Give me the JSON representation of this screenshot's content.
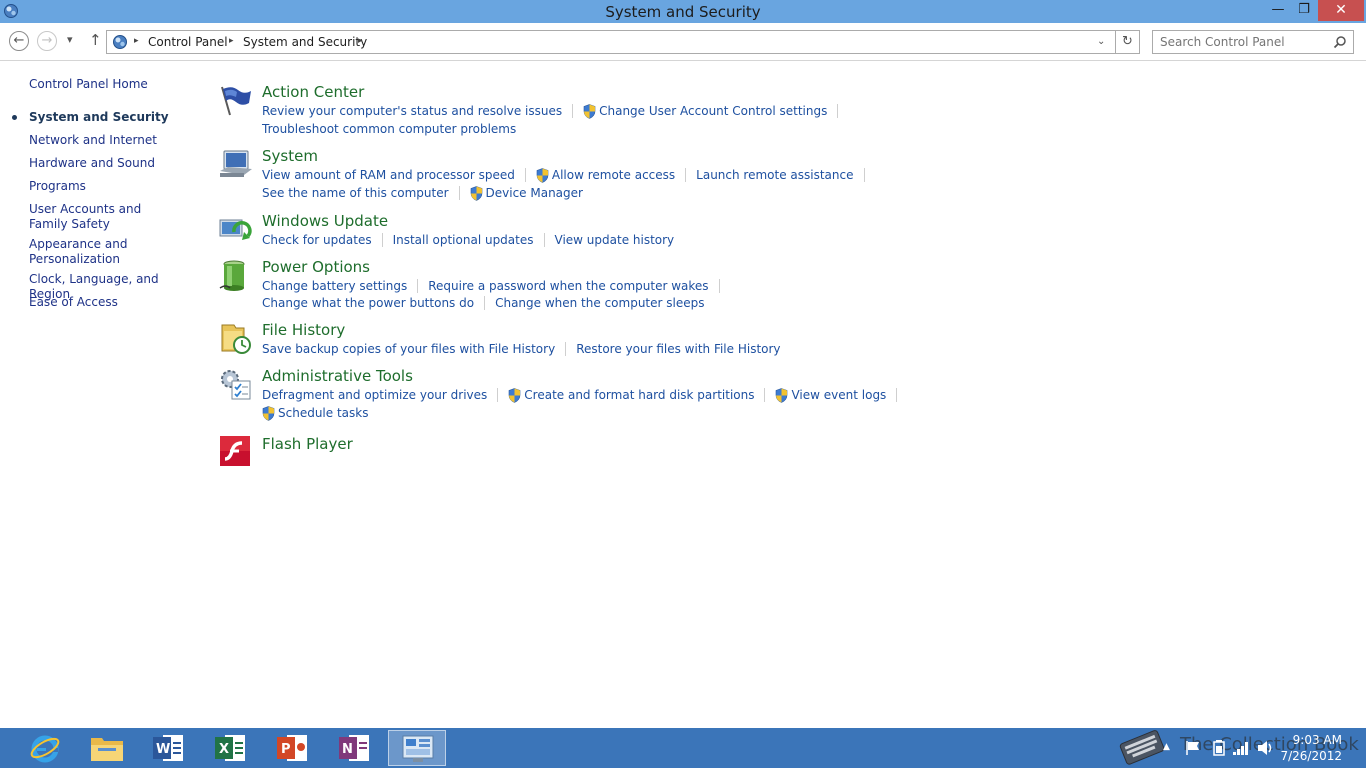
{
  "window": {
    "title": "System and Security",
    "minimize_glyph": "—",
    "restore_glyph": "❐",
    "close_glyph": "✕"
  },
  "nav": {
    "back_glyph": "←",
    "forward_glyph": "→",
    "recent_glyph": "▾",
    "up_glyph": "↑",
    "refresh_glyph": "↻",
    "breadcrumb": [
      "Control Panel",
      "System and Security"
    ],
    "crumb_sep": "▸",
    "address_dropdown_glyph": "⌄"
  },
  "search": {
    "placeholder": "Search Control Panel"
  },
  "sidebar": {
    "home": "Control Panel Home",
    "items": [
      {
        "label": "System and Security",
        "current": true
      },
      {
        "label": "Network and Internet"
      },
      {
        "label": "Hardware and Sound"
      },
      {
        "label": "Programs"
      },
      {
        "label": "User Accounts and Family Safety"
      },
      {
        "label": "Appearance and Personalization"
      },
      {
        "label": "Clock, Language, and Region"
      },
      {
        "label": "Ease of Access"
      }
    ]
  },
  "categories": [
    {
      "title": "Action Center",
      "icon": "flag-icon",
      "rows": [
        [
          {
            "label": "Review your computer's status and resolve issues"
          },
          {
            "label": "Change User Account Control settings",
            "shield": true
          }
        ],
        [
          {
            "label": "Troubleshoot common computer problems"
          }
        ]
      ]
    },
    {
      "title": "System",
      "icon": "computer-icon",
      "rows": [
        [
          {
            "label": "View amount of RAM and processor speed"
          },
          {
            "label": "Allow remote access",
            "shield": true
          },
          {
            "label": "Launch remote assistance"
          }
        ],
        [
          {
            "label": "See the name of this computer"
          },
          {
            "label": "Device Manager",
            "shield": true
          }
        ]
      ]
    },
    {
      "title": "Windows Update",
      "icon": "windows-update-icon",
      "rows": [
        [
          {
            "label": "Check for updates"
          },
          {
            "label": "Install optional updates"
          },
          {
            "label": "View update history"
          }
        ]
      ]
    },
    {
      "title": "Power Options",
      "icon": "battery-icon",
      "rows": [
        [
          {
            "label": "Change battery settings"
          },
          {
            "label": "Require a password when the computer wakes"
          }
        ],
        [
          {
            "label": "Change what the power buttons do"
          },
          {
            "label": "Change when the computer sleeps"
          }
        ]
      ]
    },
    {
      "title": "File History",
      "icon": "file-history-icon",
      "rows": [
        [
          {
            "label": "Save backup copies of your files with File History"
          },
          {
            "label": "Restore your files with File History"
          }
        ]
      ]
    },
    {
      "title": "Administrative Tools",
      "icon": "admin-tools-icon",
      "rows": [
        [
          {
            "label": "Defragment and optimize your drives"
          },
          {
            "label": "Create and format hard disk partitions",
            "shield": true
          },
          {
            "label": "View event logs",
            "shield": true
          }
        ],
        [
          {
            "label": "Schedule tasks",
            "shield": true
          }
        ]
      ]
    },
    {
      "title": "Flash Player",
      "icon": "flash-player-icon",
      "rows": []
    }
  ],
  "taskbar": {
    "apps": [
      {
        "name": "internet-explorer",
        "active": false
      },
      {
        "name": "file-explorer",
        "active": false
      },
      {
        "name": "word",
        "active": false
      },
      {
        "name": "excel",
        "active": false
      },
      {
        "name": "powerpoint",
        "active": false
      },
      {
        "name": "onenote",
        "active": false
      },
      {
        "name": "control-panel",
        "active": true
      }
    ],
    "clock_time": "9:03 AM",
    "clock_date": "7/26/2012",
    "watermark": "The Collection Book",
    "tray_up_glyph": "▲"
  },
  "colors": {
    "titlebar": "#69a5e0",
    "taskbar": "#3b75b9",
    "link": "#1e50a0",
    "category_title": "#1e6d2c",
    "close_button": "#c75050"
  }
}
